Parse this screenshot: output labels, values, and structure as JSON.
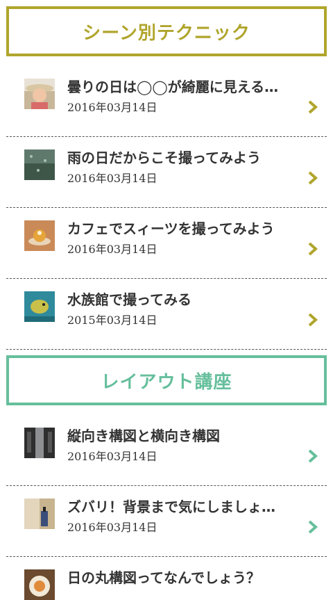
{
  "sections": [
    {
      "title": "シーン別テクニック",
      "accent": "#b0a52c",
      "items": [
        {
          "title": "曇りの日は◯◯が綺麗に見える…",
          "date": "2016年03月14日",
          "thumb": "person-portrait"
        },
        {
          "title": "雨の日だからこそ撮ってみよう",
          "date": "2016年03月14日",
          "thumb": "rainy-window"
        },
        {
          "title": "カフェでスィーツを撮ってみよう",
          "date": "2016年03月14日",
          "thumb": "dessert"
        },
        {
          "title": "水族館で撮ってみる",
          "date": "2015年03月14日",
          "thumb": "pufferfish"
        }
      ]
    },
    {
      "title": "レイアウト講座",
      "accent": "#66bf9c",
      "items": [
        {
          "title": "縦向き構図と横向き構図",
          "date": "2016年03月14日",
          "thumb": "street"
        },
        {
          "title": "ズバリ！背景まで気にしましょ…",
          "date": "2016年03月14日",
          "thumb": "bottle"
        },
        {
          "title": "日の丸構図ってなんでしょう？",
          "date": "",
          "thumb": "food-plate"
        }
      ]
    }
  ]
}
